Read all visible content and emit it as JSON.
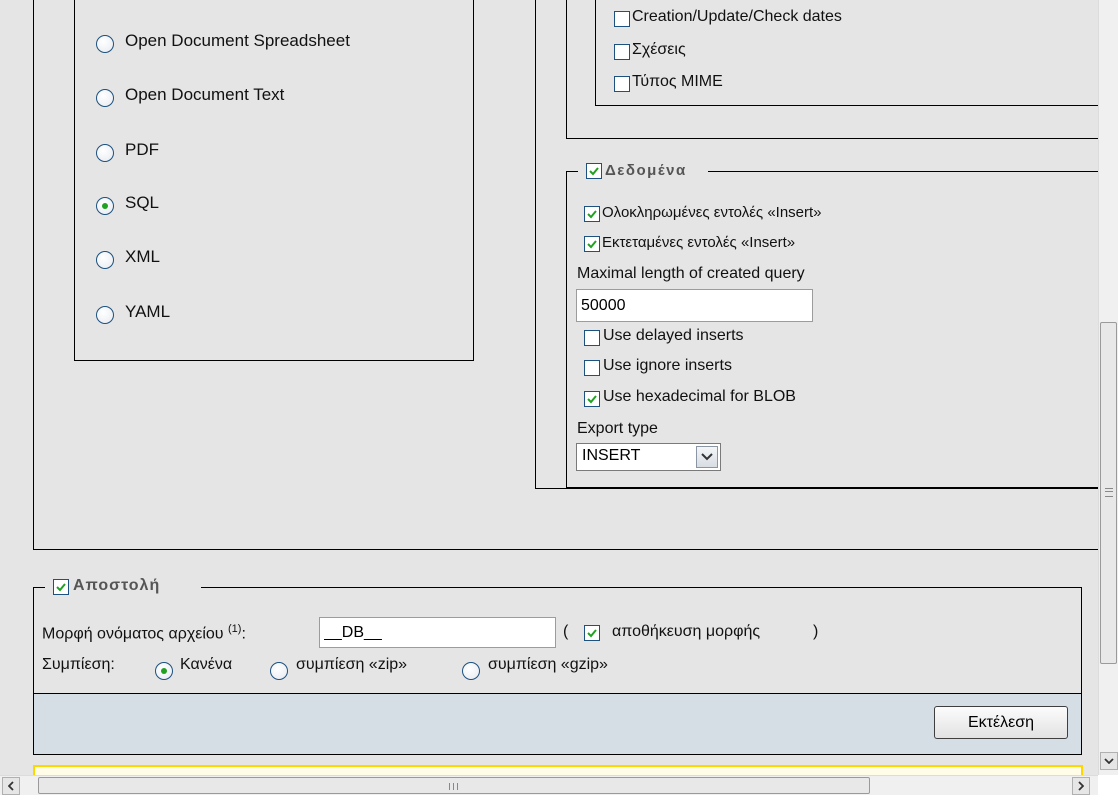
{
  "formats": [
    {
      "label": "Open Document Spreadsheet",
      "selected": false
    },
    {
      "label": "Open Document Text",
      "selected": false
    },
    {
      "label": "PDF",
      "selected": false
    },
    {
      "label": "SQL",
      "selected": true
    },
    {
      "label": "XML",
      "selected": false
    },
    {
      "label": "YAML",
      "selected": false
    }
  ],
  "structure": {
    "options": [
      {
        "label": "Creation/Update/Check dates",
        "checked": false
      },
      {
        "label": "Σχέσεις",
        "checked": false
      },
      {
        "label": "Τύπος MIME",
        "checked": false
      }
    ]
  },
  "data_section": {
    "legend": "Δεδομένα",
    "checked": true,
    "complete_inserts": "Ολοκληρωμένες εντολές «Insert»",
    "extended_inserts": "Εκτεταμένες εντολές «Insert»",
    "max_length_label": "Maximal length of created query",
    "max_length_value": "50000",
    "delayed_inserts": "Use delayed inserts",
    "ignore_inserts": "Use ignore inserts",
    "hex_blob": "Use hexadecimal for BLOB",
    "export_type_label": "Export type",
    "export_type_value": "INSERT"
  },
  "send": {
    "legend": "Αποστολή",
    "filename_label": "Μορφή ονόματος αρχείου",
    "filename_sup": "(1)",
    "filename_colon": ":",
    "filename_value": "__DB__",
    "paren_open": "(",
    "remember_label": "αποθήκευση μορφής",
    "paren_close": ")",
    "compression_label": "Συμπίεση:",
    "compression": [
      {
        "label": "Κανένα",
        "selected": true
      },
      {
        "label": "συμπίεση «zip»",
        "selected": false
      },
      {
        "label": "συμπίεση «gzip»",
        "selected": false
      }
    ]
  },
  "go_button": "Εκτέλεση",
  "colors": {
    "check": "#21a121",
    "border": "#1c5180",
    "panel": "#e5e5e5",
    "footer": "#d5dde5",
    "notice": "#ffd700"
  },
  "icons": {
    "check": "checkmark-icon",
    "dropdown": "chevron-down-icon",
    "scroll_up": "up-arrow-icon",
    "scroll_down": "down-arrow-icon",
    "scroll_left": "left-arrow-icon",
    "scroll_right": "right-arrow-icon"
  }
}
